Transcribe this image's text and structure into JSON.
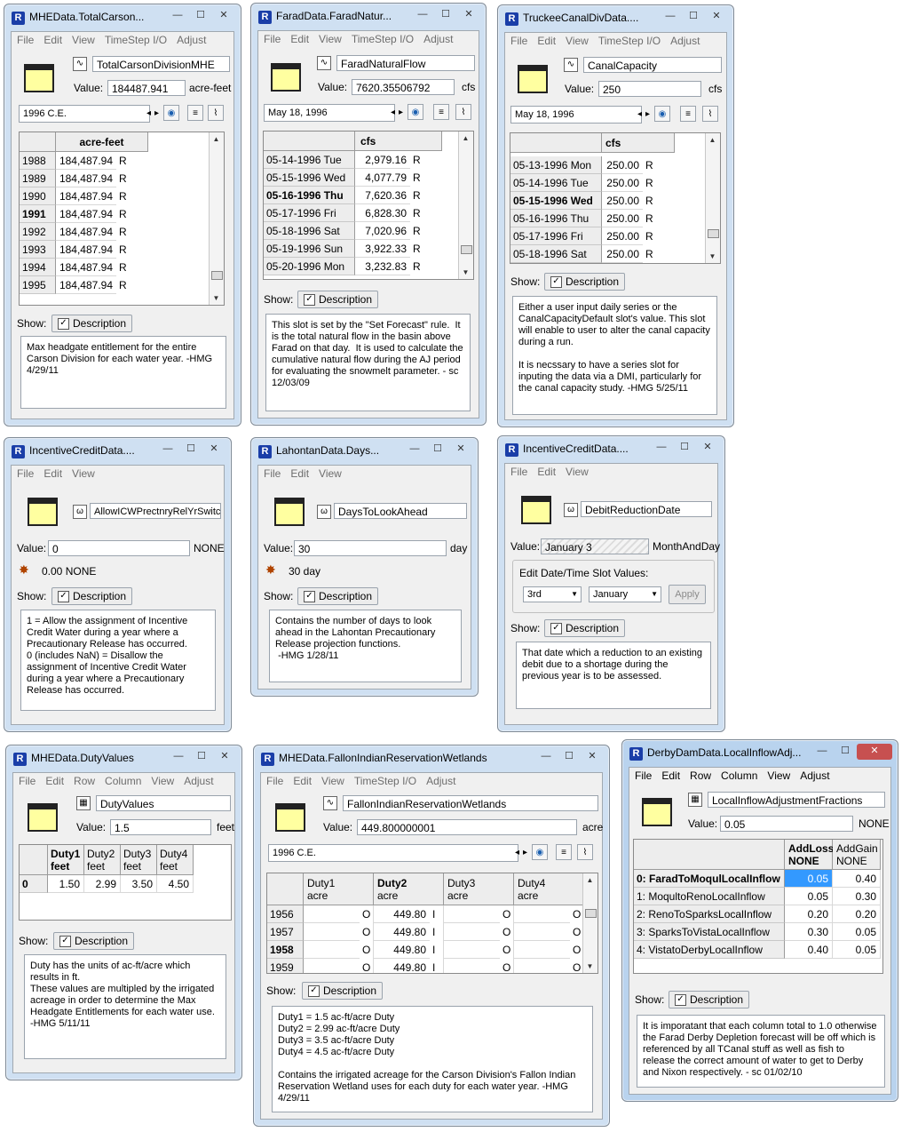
{
  "w1": {
    "title": "MHEData.TotalCarson...",
    "menu": [
      "File",
      "Edit",
      "View",
      "TimeStep I/O",
      "Adjust"
    ],
    "slot_name": "TotalCarsonDivisionMHE",
    "value_label": "Value:",
    "value": "184487.941",
    "units": "acre-feet",
    "date": "1996 C.E.",
    "col_header": "acre-feet",
    "rows": [
      {
        "label": "1988",
        "value": "184,487.94",
        "flag": "R",
        "bold": false
      },
      {
        "label": "1989",
        "value": "184,487.94",
        "flag": "R",
        "bold": false
      },
      {
        "label": "1990",
        "value": "184,487.94",
        "flag": "R",
        "bold": false
      },
      {
        "label": "1991",
        "value": "184,487.94",
        "flag": "R",
        "bold": true
      },
      {
        "label": "1992",
        "value": "184,487.94",
        "flag": "R",
        "bold": false
      },
      {
        "label": "1993",
        "value": "184,487.94",
        "flag": "R",
        "bold": false
      },
      {
        "label": "1994",
        "value": "184,487.94",
        "flag": "R",
        "bold": false
      },
      {
        "label": "1995",
        "value": "184,487.94",
        "flag": "R",
        "bold": false
      }
    ],
    "show_label": "Show:",
    "description_btn": "Description",
    "description": "Max headgate entitlement for the entire Carson Division for each water year. -HMG 4/29/11"
  },
  "w2": {
    "title": "FaradData.FaradNatur...",
    "menu": [
      "File",
      "Edit",
      "View",
      "TimeStep I/O",
      "Adjust"
    ],
    "slot_name": "FaradNaturalFlow",
    "value_label": "Value:",
    "value": "7620.35506792",
    "units": "cfs",
    "date": "May 18, 1996",
    "col_header": "cfs",
    "rows": [
      {
        "label": "05-14-1996 Tue",
        "value": "2,979.16",
        "flag": "R",
        "bold": false
      },
      {
        "label": "05-15-1996 Wed",
        "value": "4,077.79",
        "flag": "R",
        "bold": false
      },
      {
        "label": "05-16-1996 Thu",
        "value": "7,620.36",
        "flag": "R",
        "bold": true
      },
      {
        "label": "05-17-1996 Fri",
        "value": "6,828.30",
        "flag": "R",
        "bold": false
      },
      {
        "label": "05-18-1996 Sat",
        "value": "7,020.96",
        "flag": "R",
        "bold": false
      },
      {
        "label": "05-19-1996 Sun",
        "value": "3,922.33",
        "flag": "R",
        "bold": false
      },
      {
        "label": "05-20-1996 Mon",
        "value": "3,232.83",
        "flag": "R",
        "bold": false
      }
    ],
    "show_label": "Show:",
    "description_btn": "Description",
    "description": "This slot is set by the \"Set Forecast\" rule.  It is the total natural flow in the basin above Farad on that day.  It is used to calculate the cumulative natural flow during the AJ period for evaluating the snowmelt parameter. - sc 12/03/09"
  },
  "w3": {
    "title": "TruckeeCanalDivData....",
    "menu": [
      "File",
      "Edit",
      "View",
      "TimeStep I/O",
      "Adjust"
    ],
    "slot_name": "CanalCapacity",
    "value_label": "Value:",
    "value": "250",
    "units": "cfs",
    "date": "May 18, 1996",
    "col_header": "cfs",
    "rows": [
      {
        "label": "05-13-1996 Mon",
        "value": "250.00",
        "flag": "R",
        "bold": false
      },
      {
        "label": "05-14-1996 Tue",
        "value": "250.00",
        "flag": "R",
        "bold": false
      },
      {
        "label": "05-15-1996 Wed",
        "value": "250.00",
        "flag": "R",
        "bold": true
      },
      {
        "label": "05-16-1996 Thu",
        "value": "250.00",
        "flag": "R",
        "bold": false
      },
      {
        "label": "05-17-1996 Fri",
        "value": "250.00",
        "flag": "R",
        "bold": false
      },
      {
        "label": "05-18-1996 Sat",
        "value": "250.00",
        "flag": "R",
        "bold": false
      }
    ],
    "show_label": "Show:",
    "description_btn": "Description",
    "description": "Either a user input daily series or the CanalCapacityDefault slot's value. This slot will enable to user to alter the canal capacity during a run.\n\nIt is necssary to have a series slot for inputing the data via a DMI, particularly for the canal capacity study. -HMG 5/25/11"
  },
  "w4": {
    "title": "IncentiveCreditData....",
    "menu": [
      "File",
      "Edit",
      "View"
    ],
    "slot_name": "AllowICWPrectnryRelYrSwitch",
    "value_label": "Value:",
    "value": "0",
    "units": "NONE",
    "expr": "0.00 NONE",
    "show_label": "Show:",
    "description_btn": "Description",
    "description": "1 = Allow the assignment of Incentive Credit Water during a year where a Precautionary Release has occurred.\n0 (includes NaN) = Disallow the assignment of Incentive Credit Water during a year where a Precautionary Release has occurred."
  },
  "w5": {
    "title": "LahontanData.Days...",
    "menu": [
      "File",
      "Edit",
      "View"
    ],
    "slot_name": "DaysToLookAhead",
    "value_label": "Value:",
    "value": "30",
    "units": "day",
    "expr": "30 day",
    "show_label": "Show:",
    "description_btn": "Description",
    "description": "Contains the number of days to look ahead in the Lahontan Precautionary Release projection functions.\n -HMG 1/28/11"
  },
  "w6": {
    "title": "IncentiveCreditData....",
    "menu": [
      "File",
      "Edit",
      "View"
    ],
    "slot_name": "DebitReductionDate",
    "value_label": "Value:",
    "value": "January 3",
    "units": "MonthAndDay",
    "edit_label": "Edit Date/Time Slot Values:",
    "day_sel": "3rd",
    "month_sel": "January",
    "apply": "Apply",
    "show_label": "Show:",
    "description_btn": "Description",
    "description": "That date which a reduction to an existing debit due to a shortage during the previous year is to be assessed."
  },
  "w7": {
    "title": "MHEData.DutyValues",
    "menu": [
      "File",
      "Edit",
      "Row",
      "Column",
      "View",
      "Adjust"
    ],
    "slot_name": "DutyValues",
    "value_label": "Value:",
    "value": "1.5",
    "units": "feet",
    "cols": [
      {
        "name": "Duty1",
        "unit": "feet",
        "value": "1.50",
        "bold": true
      },
      {
        "name": "Duty2",
        "unit": "feet",
        "value": "2.99",
        "bold": false
      },
      {
        "name": "Duty3",
        "unit": "feet",
        "value": "3.50",
        "bold": false
      },
      {
        "name": "Duty4",
        "unit": "feet",
        "value": "4.50",
        "bold": false
      }
    ],
    "row_label": "0",
    "show_label": "Show:",
    "description_btn": "Description",
    "description": "Duty has the units of ac-ft/acre which results in ft.\nThese values are multipled by the irrigated acreage in order to determine the Max Headgate Entitlements for each water use. -HMG 5/11/11"
  },
  "w8": {
    "title": "MHEData.FallonIndianReservationWetlands",
    "menu": [
      "File",
      "Edit",
      "View",
      "TimeStep I/O",
      "Adjust"
    ],
    "slot_name": "FallonIndianReservationWetlands",
    "value_label": "Value:",
    "value": "449.800000001",
    "units": "acre",
    "date": "1996 C.E.",
    "cols": [
      {
        "name": "Duty1",
        "unit": "acre",
        "bold": false
      },
      {
        "name": "Duty2",
        "unit": "acre",
        "bold": true
      },
      {
        "name": "Duty3",
        "unit": "acre",
        "bold": false
      },
      {
        "name": "Duty4",
        "unit": "acre",
        "bold": false
      }
    ],
    "rows": [
      {
        "label": "1956",
        "bold": false,
        "cells": [
          {
            "v": "",
            "f": "O"
          },
          {
            "v": "449.80",
            "f": "I"
          },
          {
            "v": "",
            "f": "O"
          },
          {
            "v": "",
            "f": "O"
          }
        ]
      },
      {
        "label": "1957",
        "bold": false,
        "cells": [
          {
            "v": "",
            "f": "O"
          },
          {
            "v": "449.80",
            "f": "I"
          },
          {
            "v": "",
            "f": "O"
          },
          {
            "v": "",
            "f": "O"
          }
        ]
      },
      {
        "label": "1958",
        "bold": true,
        "cells": [
          {
            "v": "",
            "f": "O"
          },
          {
            "v": "449.80",
            "f": "I"
          },
          {
            "v": "",
            "f": "O"
          },
          {
            "v": "",
            "f": "O"
          }
        ]
      },
      {
        "label": "1959",
        "bold": false,
        "cells": [
          {
            "v": "",
            "f": "O"
          },
          {
            "v": "449.80",
            "f": "I"
          },
          {
            "v": "",
            "f": "O"
          },
          {
            "v": "",
            "f": "O"
          }
        ]
      }
    ],
    "show_label": "Show:",
    "description_btn": "Description",
    "description": "Duty1 = 1.5 ac-ft/acre Duty\nDuty2 = 2.99 ac-ft/acre Duty\nDuty3 = 3.5 ac-ft/acre Duty\nDuty4 = 4.5 ac-ft/acre Duty\n\nContains the irrigated acreage for the Carson Division's Fallon Indian Reservation Wetland uses for each duty for each water year. -HMG 4/29/11"
  },
  "w9": {
    "title": "DerbyDamData.LocalInflowAdj...",
    "menu": [
      "File",
      "Edit",
      "Row",
      "Column",
      "View",
      "Adjust"
    ],
    "slot_name": "LocalInflowAdjustmentFractions",
    "value_label": "Value:",
    "value": "0.05",
    "units": "NONE",
    "cols": [
      {
        "name": "AddLoss",
        "unit": "NONE",
        "bold": true
      },
      {
        "name": "AddGain",
        "unit": "NONE",
        "bold": false
      }
    ],
    "rows": [
      {
        "label": "0: FaradToMoqulLocalInflow",
        "bold": true,
        "a": "0.05",
        "b": "0.40"
      },
      {
        "label": "1: MoqultoRenoLocalInflow",
        "bold": false,
        "a": "0.05",
        "b": "0.30"
      },
      {
        "label": "2: RenoToSparksLocalInflow",
        "bold": false,
        "a": "0.20",
        "b": "0.20"
      },
      {
        "label": "3: SparksToVistaLocalInflow",
        "bold": false,
        "a": "0.30",
        "b": "0.05"
      },
      {
        "label": "4: VistatoDerbyLocalInflow",
        "bold": false,
        "a": "0.40",
        "b": "0.05"
      }
    ],
    "show_label": "Show:",
    "description_btn": "Description",
    "description": "It is imporatant that each column total to 1.0 otherwise the Farad Derby Depletion forecast will be off which is referenced by all TCanal stuff as well as fish to release the correct amount of water to get to Derby and Nixon respectively. - sc 01/02/10"
  },
  "common": {
    "min_glyph": "—",
    "max_glyph": "☐",
    "close_glyph": "✕",
    "app_glyph": "R",
    "check_glyph": "✓",
    "prev_glyph": "◂",
    "next_glyph": "▸",
    "up_glyph": "▲",
    "down_glyph": "▼",
    "series_glyph": "∿",
    "scalar_glyph": "ω",
    "table_glyph": "▦",
    "globe_glyph": "◉",
    "list_glyph": "≡",
    "plot_glyph": "⌇",
    "gear_glyph": "✸"
  }
}
